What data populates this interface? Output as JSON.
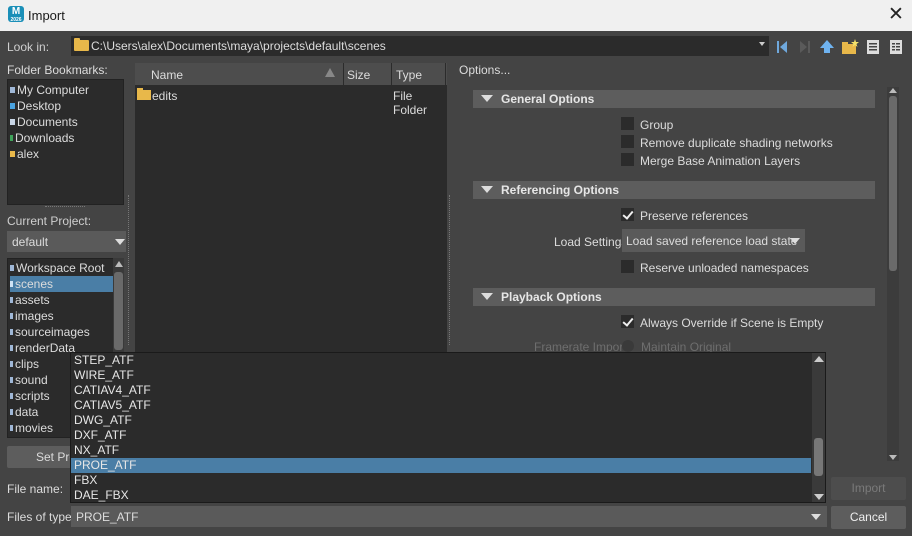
{
  "window": {
    "title": "Import",
    "app_icon_letter": "M",
    "app_icon_sub": "2026"
  },
  "lookin": {
    "label": "Look in:",
    "path": "C:\\Users\\alex\\Documents\\maya\\projects\\default\\scenes"
  },
  "bookmarks": {
    "label": "Folder Bookmarks:",
    "items": [
      {
        "label": "My Computer",
        "color": "#9fb7d6"
      },
      {
        "label": "Desktop",
        "color": "#4aa3e0"
      },
      {
        "label": "Documents",
        "color": "#c9d6e6"
      },
      {
        "label": "Downloads",
        "color": "#3fa35a"
      },
      {
        "label": "alex",
        "color": "#e8b84a"
      }
    ]
  },
  "project": {
    "label": "Current Project:",
    "value": "default",
    "workspace_items": [
      "Workspace Root",
      "scenes",
      "assets",
      "images",
      "sourceimages",
      "renderData",
      "clips",
      "sound",
      "scripts",
      "data",
      "movies"
    ],
    "selected_index": 1,
    "set_project_label": "Set Pro"
  },
  "files": {
    "columns": [
      "Name",
      "Size",
      "Type"
    ],
    "rows": [
      {
        "name": "edits",
        "size": "",
        "type": "File Folder"
      }
    ]
  },
  "options": {
    "label": "Options...",
    "sections": {
      "general": {
        "title": "General Options"
      },
      "referencing": {
        "title": "Referencing Options"
      },
      "playback": {
        "title": "Playback Options"
      }
    },
    "general": {
      "group": {
        "label": "Group",
        "checked": false
      },
      "remove_dup": {
        "label": "Remove duplicate shading networks",
        "checked": false
      },
      "merge_base": {
        "label": "Merge Base Animation Layers",
        "checked": false
      }
    },
    "referencing": {
      "preserve": {
        "label": "Preserve references",
        "checked": true
      },
      "load_settings_label": "Load Settings",
      "load_settings_value": "Load saved reference load state",
      "reserve": {
        "label": "Reserve unloaded namespaces",
        "checked": false
      }
    },
    "playback": {
      "always_override": {
        "label": "Always Override if Scene is Empty",
        "checked": true
      },
      "framerate_label": "Framerate Import",
      "framerate_option": "Maintain Original"
    }
  },
  "bottom": {
    "file_name_label": "File name:",
    "files_of_type_label": "Files of type:",
    "files_of_type_value": "PROE_ATF",
    "import_label": "Import",
    "cancel_label": "Cancel"
  },
  "dropdown": {
    "options": [
      "STEP_ATF",
      "WIRE_ATF",
      "CATIAV4_ATF",
      "CATIAV5_ATF",
      "DWG_ATF",
      "DXF_ATF",
      "NX_ATF",
      "PROE_ATF",
      "FBX",
      "DAE_FBX"
    ],
    "selected": "PROE_ATF"
  }
}
